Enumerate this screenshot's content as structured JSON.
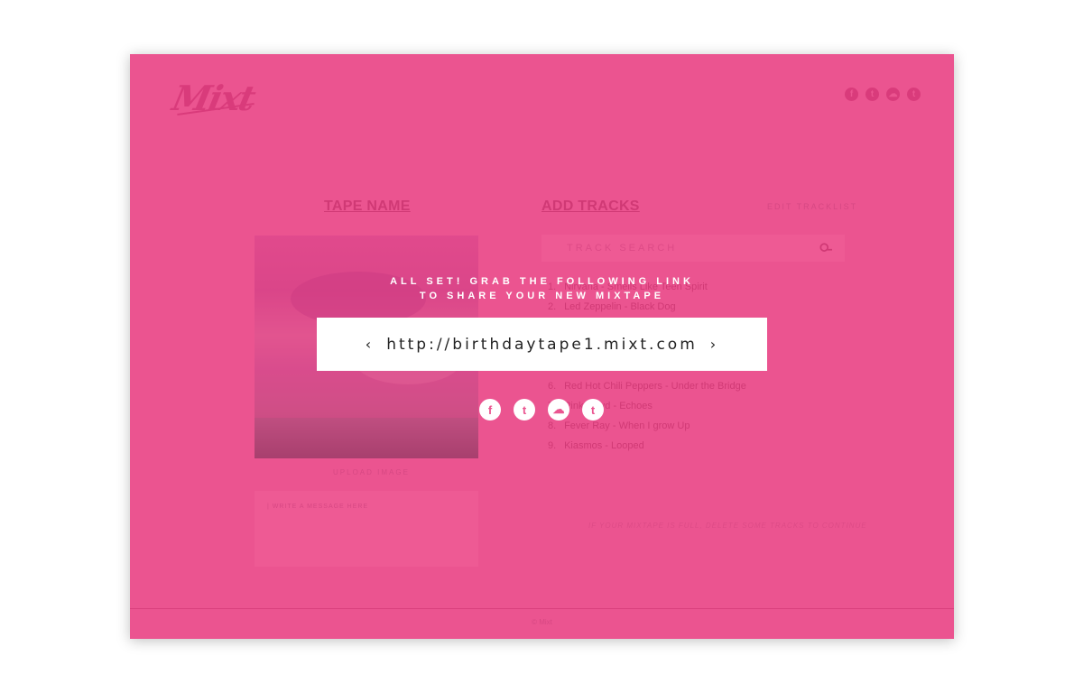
{
  "brand": {
    "logo": "Mixt"
  },
  "header": {
    "social": [
      {
        "icon": "facebook-icon",
        "glyph": "f"
      },
      {
        "icon": "twitter-icon",
        "glyph": "t"
      },
      {
        "icon": "soundcloud-icon",
        "glyph": "☁"
      },
      {
        "icon": "tumblr-icon",
        "glyph": "t"
      }
    ]
  },
  "left": {
    "heading": "TAPE NAME",
    "upload_label": "UPLOAD IMAGE",
    "message_placeholder": "| WRITE A MESSAGE HERE"
  },
  "right": {
    "heading": "ADD TRACKS",
    "edit_label": "EDIT TRACKLIST",
    "search_placeholder": "TRACK SEARCH",
    "tracks": [
      {
        "num": "1.",
        "title": "Nirvana - Smells Like Teen Spirit"
      },
      {
        "num": "2.",
        "title": "Led Zeppelin - Black Dog"
      },
      {
        "num": "",
        "title": ""
      },
      {
        "num": "",
        "title": ""
      },
      {
        "num": "",
        "title": ""
      },
      {
        "num": "6.",
        "title": "Red Hot Chili Peppers - Under the Bridge"
      },
      {
        "num": "7.",
        "title": "Pink Floyd - Echoes"
      },
      {
        "num": "8.",
        "title": "Fever Ray - When I grow Up"
      },
      {
        "num": "9.",
        "title": "Kiasmos - Looped"
      }
    ],
    "full_note": "IF YOUR MIXTAPE IS FULL, DELETE SOME TRACKS TO CONTINUE"
  },
  "footer": {
    "text": "© Mixt"
  },
  "share": {
    "line1": "ALL SET! GRAB THE FOLLOWING LINK",
    "line2": "TO SHARE YOUR NEW MIXTAPE",
    "url": "http://birthdaytape1.mixt.com",
    "prev": "‹",
    "next": "›",
    "icons": [
      {
        "icon": "facebook-share-icon",
        "glyph": "f"
      },
      {
        "icon": "twitter-share-icon",
        "glyph": "t"
      },
      {
        "icon": "soundcloud-share-icon",
        "glyph": "☁"
      },
      {
        "icon": "tumblr-share-icon",
        "glyph": "t"
      }
    ]
  },
  "colors": {
    "page_pink": "#ea5590",
    "accent": "#b8245f",
    "white": "#ffffff"
  }
}
